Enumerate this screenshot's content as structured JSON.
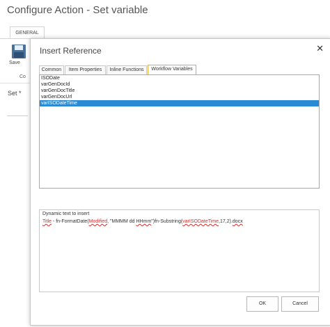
{
  "window_title": "Configure Action - Set variable",
  "ribbon": {
    "tab_label": "GENERAL",
    "save_label": "Save",
    "group_label_partial": "Co"
  },
  "background_form": {
    "set_label": "Set *"
  },
  "dialog": {
    "title": "Insert Reference",
    "close_glyph": "✕",
    "tabs": [
      {
        "label": "Common",
        "active": false
      },
      {
        "label": "Item Properties",
        "active": false
      },
      {
        "label": "Inline Functions",
        "active": false
      },
      {
        "label": "Workflow Variables",
        "active": true
      }
    ],
    "list_items": [
      {
        "label": "ISODate",
        "selected": false
      },
      {
        "label": "varGenDocId",
        "selected": false
      },
      {
        "label": "varGenDocTitle",
        "selected": false
      },
      {
        "label": "varGenDocUrl",
        "selected": false
      },
      {
        "label": "varISODateTime",
        "selected": true
      }
    ],
    "dynamic_text": {
      "label": "Dynamic text to insert",
      "segments": [
        {
          "text": "Title",
          "type": "ref"
        },
        {
          "text": " - fn-FormatDate(",
          "type": "plain"
        },
        {
          "text": "Modified",
          "type": "ref"
        },
        {
          "text": ", \"MMMM dd ",
          "type": "plain"
        },
        {
          "text": "HHmm",
          "type": "underline"
        },
        {
          "text": "\")fn-Substring(",
          "type": "plain"
        },
        {
          "text": "varISODateTime",
          "type": "ref"
        },
        {
          "text": ",17,2).",
          "type": "plain"
        },
        {
          "text": "docx",
          "type": "underline"
        }
      ]
    },
    "ok_label": "OK",
    "cancel_label": "Cancel"
  },
  "colors": {
    "selection": "#2a8ad4",
    "active_tab_border": "#e5a82b",
    "reference_text": "#d42b2b"
  }
}
